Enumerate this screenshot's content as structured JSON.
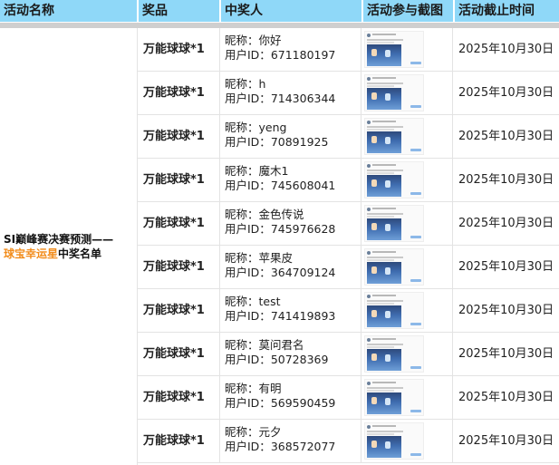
{
  "header": {
    "activity_name": "活动名称",
    "prize": "奖品",
    "winner": "中奖人",
    "screenshot": "活动参与截图",
    "deadline": "活动截止时间"
  },
  "activity": {
    "title_line1": "SI巅峰赛决赛预测——",
    "title_highlight": "球宝幸运星",
    "title_suffix": "中奖名单"
  },
  "labels": {
    "nickname_prefix": "昵称：",
    "userid_prefix": "用户ID："
  },
  "rows": [
    {
      "prize": "万能球球*1",
      "nickname": "你好",
      "user_id": "671180197",
      "deadline": "2025年10月30日"
    },
    {
      "prize": "万能球球*1",
      "nickname": "h",
      "user_id": "714306344",
      "deadline": "2025年10月30日"
    },
    {
      "prize": "万能球球*1",
      "nickname": "yeng",
      "user_id": "70891925",
      "deadline": "2025年10月30日"
    },
    {
      "prize": "万能球球*1",
      "nickname": "魔木1",
      "user_id": "745608041",
      "deadline": "2025年10月30日"
    },
    {
      "prize": "万能球球*1",
      "nickname": "金色传说",
      "user_id": "745976628",
      "deadline": "2025年10月30日"
    },
    {
      "prize": "万能球球*1",
      "nickname": "苹果皮",
      "user_id": "364709124",
      "deadline": "2025年10月30日"
    },
    {
      "prize": "万能球球*1",
      "nickname": "test",
      "user_id": "741419893",
      "deadline": "2025年10月30日"
    },
    {
      "prize": "万能球球*1",
      "nickname": "莫问君名",
      "user_id": "50728369",
      "deadline": "2025年10月30日"
    },
    {
      "prize": "万能球球*1",
      "nickname": "有明",
      "user_id": "569590459",
      "deadline": "2025年10月30日"
    },
    {
      "prize": "万能球球*1",
      "nickname": "元夕",
      "user_id": "368572077",
      "deadline": "2025年10月30日"
    }
  ],
  "colors": {
    "header_bg": "#8fd8f8",
    "highlight": "#f28c1b"
  }
}
